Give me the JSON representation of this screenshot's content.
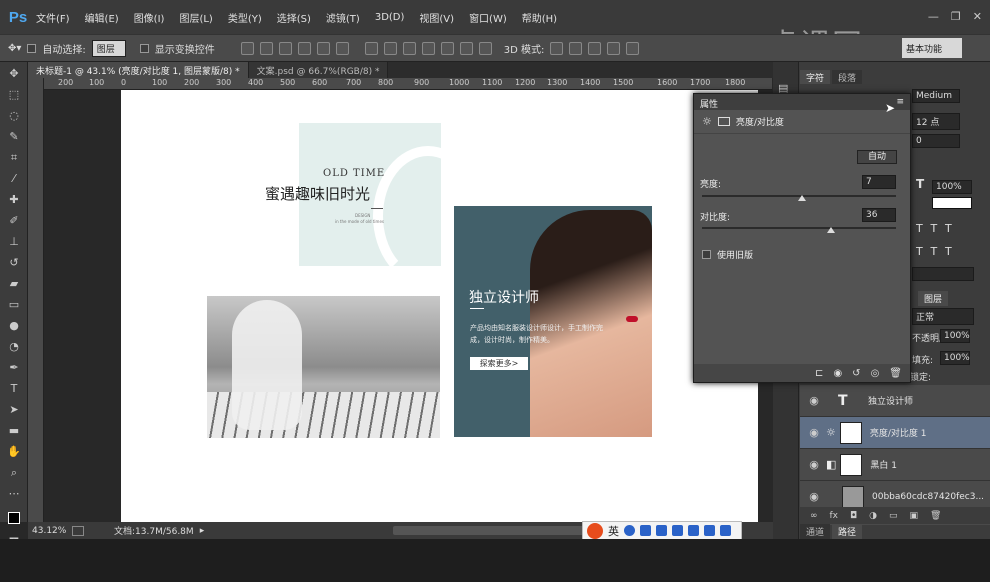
{
  "app": {
    "logo": "Ps"
  },
  "menu": [
    "文件(F)",
    "编辑(E)",
    "图像(I)",
    "图层(L)",
    "类型(Y)",
    "选择(S)",
    "滤镜(T)",
    "3D(D)",
    "视图(V)",
    "窗口(W)",
    "帮助(H)"
  ],
  "options": {
    "auto_select_label": "自动选择:",
    "auto_select_value": "图层",
    "show_transform": "显示变换控件",
    "mode3d": "3D 模式:",
    "workspace": "基本功能"
  },
  "watermark": "虎课网",
  "tabs": [
    "未标题-1 @ 43.1% (亮度/对比度 1, 图层蒙版/8) *",
    "文案.psd @ 66.7%(RGB/8) *"
  ],
  "ruler": [
    "200",
    "100",
    "0",
    "100",
    "200",
    "300",
    "400",
    "500",
    "600",
    "700",
    "800",
    "900",
    "1000",
    "1100",
    "1200",
    "1300",
    "1400",
    "1500",
    "1600",
    "1700",
    "1800"
  ],
  "status": {
    "zoom": "43.12%",
    "doc": "文档:13.7M/56.8M"
  },
  "ime": {
    "label": "英"
  },
  "char_panel": {
    "tab1": "字符",
    "tab2": "段落",
    "font_style": "Medium",
    "font_size": "12 点",
    "tracking": "0",
    "scale": "100%"
  },
  "props": {
    "title": "属性",
    "adjust_name": "亮度/对比度",
    "auto": "自动",
    "brightness_label": "亮度:",
    "brightness": "7",
    "contrast_label": "对比度:",
    "contrast": "36",
    "legacy": "使用旧版"
  },
  "layers_panel": {
    "tab": "图层",
    "blend": "正常",
    "opacity_label": "不透明度:",
    "opacity": "100%",
    "fill_label": "填充:",
    "fill": "100%",
    "lock_label": "锁定:",
    "rows": [
      {
        "name": "独立设计师"
      },
      {
        "name": "亮度/对比度 1"
      },
      {
        "name": "黑白 1"
      },
      {
        "name": "00bba60cdc87420fec3..."
      }
    ]
  },
  "path_tabs": [
    "通道",
    "路径"
  ],
  "artwork": {
    "old_time": "OLD TIME",
    "title_cn": "蜜遇趣味旧时光",
    "small_en": "DESIGN",
    "small_en2": "in the mode of old times",
    "designer_title": "独立设计师",
    "designer_desc": "产品均由知名服装设计师设计，手工制作完成，设计时尚，制作精美。",
    "explore_btn": "探索更多>"
  },
  "colors": {
    "accent_mint": "#e3efed",
    "accent_teal": "#42606a",
    "lip": "#c0102a"
  }
}
